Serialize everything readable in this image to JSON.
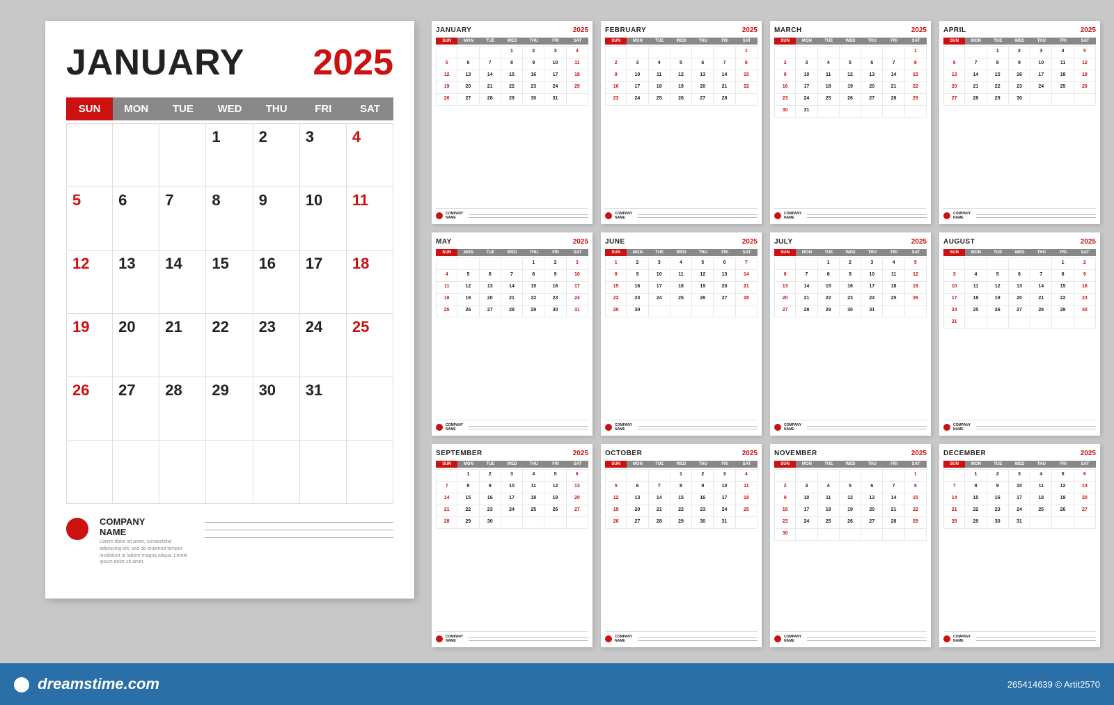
{
  "app": {
    "bg_color": "#c8c8c8"
  },
  "main_calendar": {
    "month": "JANUARY",
    "year": "2025",
    "days_of_week": [
      "SUN",
      "MON",
      "TUE",
      "WED",
      "THU",
      "FRI",
      "SAT"
    ],
    "weeks": [
      [
        "",
        "",
        "",
        "1",
        "2",
        "3",
        "4"
      ],
      [
        "5",
        "6",
        "7",
        "8",
        "9",
        "10",
        "11"
      ],
      [
        "12",
        "13",
        "14",
        "15",
        "16",
        "17",
        "18"
      ],
      [
        "19",
        "20",
        "21",
        "22",
        "23",
        "24",
        "25"
      ],
      [
        "26",
        "27",
        "28",
        "29",
        "30",
        "31",
        ""
      ],
      [
        "",
        "",
        "",
        "",
        "",
        "",
        ""
      ]
    ],
    "company_name": "COMPANY\nNAME",
    "company_desc": "Lorem dolor sit amet, consectetur adipiscing elit, sed do eiusmod tempor incididunt ut labore magna aliqua. Lorem ipsum dolor sit amet."
  },
  "small_calendars": [
    {
      "month": "JANUARY",
      "year": "2025",
      "weeks": [
        [
          "",
          "",
          "",
          "1",
          "2",
          "3",
          "4"
        ],
        [
          "5",
          "6",
          "7",
          "8",
          "9",
          "10",
          "11"
        ],
        [
          "12",
          "13",
          "14",
          "15",
          "16",
          "17",
          "18"
        ],
        [
          "19",
          "20",
          "21",
          "22",
          "23",
          "24",
          "25"
        ],
        [
          "26",
          "27",
          "28",
          "29",
          "30",
          "31",
          ""
        ]
      ]
    },
    {
      "month": "FEBRUARY",
      "year": "2025",
      "weeks": [
        [
          "",
          "",
          "",
          "",
          "",
          "",
          "1"
        ],
        [
          "2",
          "3",
          "4",
          "5",
          "6",
          "7",
          "8"
        ],
        [
          "9",
          "10",
          "11",
          "12",
          "13",
          "14",
          "15"
        ],
        [
          "16",
          "17",
          "18",
          "19",
          "20",
          "21",
          "22"
        ],
        [
          "23",
          "24",
          "25",
          "26",
          "27",
          "28",
          ""
        ]
      ]
    },
    {
      "month": "MARCH",
      "year": "2025",
      "weeks": [
        [
          "",
          "",
          "",
          "",
          "",
          "",
          "1"
        ],
        [
          "2",
          "3",
          "4",
          "5",
          "6",
          "7",
          "8"
        ],
        [
          "9",
          "10",
          "11",
          "12",
          "13",
          "14",
          "15"
        ],
        [
          "16",
          "17",
          "18",
          "19",
          "20",
          "21",
          "22"
        ],
        [
          "23",
          "24",
          "25",
          "26",
          "27",
          "28",
          "29"
        ],
        [
          "30",
          "31",
          "",
          "",
          "",
          "",
          ""
        ]
      ]
    },
    {
      "month": "APRIL",
      "year": "2025",
      "weeks": [
        [
          "",
          "",
          "1",
          "2",
          "3",
          "4",
          "5"
        ],
        [
          "6",
          "7",
          "8",
          "9",
          "10",
          "11",
          "12"
        ],
        [
          "13",
          "14",
          "15",
          "16",
          "17",
          "18",
          "19"
        ],
        [
          "20",
          "21",
          "22",
          "23",
          "24",
          "25",
          "26"
        ],
        [
          "27",
          "28",
          "29",
          "30",
          "",
          "",
          ""
        ]
      ]
    },
    {
      "month": "MAY",
      "year": "2025",
      "weeks": [
        [
          "",
          "",
          "",
          "",
          "1",
          "2",
          "3"
        ],
        [
          "4",
          "5",
          "6",
          "7",
          "8",
          "9",
          "10"
        ],
        [
          "11",
          "12",
          "13",
          "14",
          "15",
          "16",
          "17"
        ],
        [
          "18",
          "19",
          "20",
          "21",
          "22",
          "23",
          "24"
        ],
        [
          "25",
          "26",
          "27",
          "28",
          "29",
          "30",
          "31"
        ]
      ]
    },
    {
      "month": "JUNE",
      "year": "2025",
      "weeks": [
        [
          "1",
          "2",
          "3",
          "4",
          "5",
          "6",
          "7"
        ],
        [
          "8",
          "9",
          "10",
          "11",
          "12",
          "13",
          "14"
        ],
        [
          "15",
          "16",
          "17",
          "18",
          "19",
          "20",
          "21"
        ],
        [
          "22",
          "23",
          "24",
          "25",
          "26",
          "27",
          "28"
        ],
        [
          "29",
          "30",
          "",
          "",
          "",
          "",
          ""
        ]
      ]
    },
    {
      "month": "JULY",
      "year": "2025",
      "weeks": [
        [
          "",
          "",
          "1",
          "2",
          "3",
          "4",
          "5"
        ],
        [
          "6",
          "7",
          "8",
          "9",
          "10",
          "11",
          "12"
        ],
        [
          "13",
          "14",
          "15",
          "16",
          "17",
          "18",
          "19"
        ],
        [
          "20",
          "21",
          "22",
          "23",
          "24",
          "25",
          "26"
        ],
        [
          "27",
          "28",
          "29",
          "30",
          "31",
          "",
          ""
        ]
      ]
    },
    {
      "month": "AUGUST",
      "year": "2025",
      "weeks": [
        [
          "",
          "",
          "",
          "",
          "",
          "1",
          "2"
        ],
        [
          "3",
          "4",
          "5",
          "6",
          "7",
          "8",
          "9"
        ],
        [
          "10",
          "11",
          "12",
          "13",
          "14",
          "15",
          "16"
        ],
        [
          "17",
          "18",
          "19",
          "20",
          "21",
          "22",
          "23"
        ],
        [
          "24",
          "25",
          "26",
          "27",
          "28",
          "29",
          "30"
        ],
        [
          "31",
          "",
          "",
          "",
          "",
          "",
          ""
        ]
      ]
    },
    {
      "month": "SEPTEMBER",
      "year": "2025",
      "weeks": [
        [
          "",
          "1",
          "2",
          "3",
          "4",
          "5",
          "6"
        ],
        [
          "7",
          "8",
          "9",
          "10",
          "11",
          "12",
          "13"
        ],
        [
          "14",
          "15",
          "16",
          "17",
          "18",
          "19",
          "20"
        ],
        [
          "21",
          "22",
          "23",
          "24",
          "25",
          "26",
          "27"
        ],
        [
          "28",
          "29",
          "30",
          "",
          "",
          "",
          ""
        ]
      ]
    },
    {
      "month": "OCTOBER",
      "year": "2025",
      "weeks": [
        [
          "",
          "",
          "",
          "1",
          "2",
          "3",
          "4"
        ],
        [
          "5",
          "6",
          "7",
          "8",
          "9",
          "10",
          "11"
        ],
        [
          "12",
          "13",
          "14",
          "15",
          "16",
          "17",
          "18"
        ],
        [
          "19",
          "20",
          "21",
          "22",
          "23",
          "24",
          "25"
        ],
        [
          "26",
          "27",
          "28",
          "29",
          "30",
          "31",
          ""
        ]
      ]
    },
    {
      "month": "NOVEMBER",
      "year": "2025",
      "weeks": [
        [
          "",
          "",
          "",
          "",
          "",
          "",
          "1"
        ],
        [
          "2",
          "3",
          "4",
          "5",
          "6",
          "7",
          "8"
        ],
        [
          "9",
          "10",
          "11",
          "12",
          "13",
          "14",
          "15"
        ],
        [
          "16",
          "17",
          "18",
          "19",
          "20",
          "21",
          "22"
        ],
        [
          "23",
          "24",
          "25",
          "26",
          "27",
          "28",
          "29"
        ],
        [
          "30",
          "",
          "",
          "",
          "",
          "",
          ""
        ]
      ]
    },
    {
      "month": "DECEMBER",
      "year": "2025",
      "weeks": [
        [
          "",
          "1",
          "2",
          "3",
          "4",
          "5",
          "6"
        ],
        [
          "7",
          "8",
          "9",
          "10",
          "11",
          "12",
          "13"
        ],
        [
          "14",
          "15",
          "16",
          "17",
          "18",
          "19",
          "20"
        ],
        [
          "21",
          "22",
          "23",
          "24",
          "25",
          "26",
          "27"
        ],
        [
          "28",
          "29",
          "30",
          "31",
          "",
          "",
          ""
        ]
      ]
    }
  ],
  "dreamstime": {
    "logo_text": "dreamstime.com",
    "info": "265414639 © Artit2570"
  }
}
